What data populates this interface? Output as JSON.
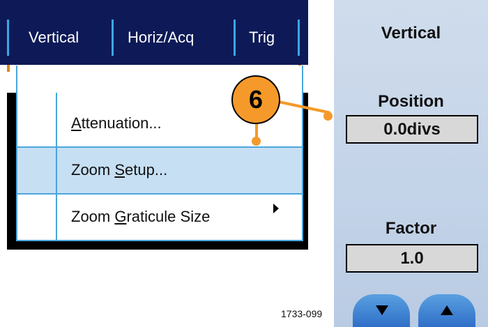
{
  "menubar": {
    "tabs": [
      {
        "label": "Vertical"
      },
      {
        "label": "Horiz/Acq"
      },
      {
        "label": "Trig"
      }
    ]
  },
  "menu": {
    "items": [
      {
        "pre": "",
        "u": "A",
        "post": "ttenuation..."
      },
      {
        "pre": "Zoom ",
        "u": "S",
        "post": "etup..."
      },
      {
        "pre": "Zoom ",
        "u": "G",
        "post": "raticule Size"
      }
    ]
  },
  "callout": {
    "number": "6"
  },
  "panel": {
    "title": "Vertical",
    "position": {
      "label": "Position",
      "value": "0.0divs"
    },
    "factor": {
      "label": "Factor",
      "value": "1.0"
    },
    "buttons": {
      "down": "down-arrow",
      "up": "up-arrow"
    }
  },
  "figure_id": "1733-099",
  "colors": {
    "menubar_bg": "#0d1a57",
    "separator": "#3ba6e6",
    "menu_border": "#4aa6dc",
    "highlight": "#c6dff3",
    "callout": "#f59a2a",
    "panel_bg": "#c3d3e8",
    "button": "#3f86d6"
  }
}
